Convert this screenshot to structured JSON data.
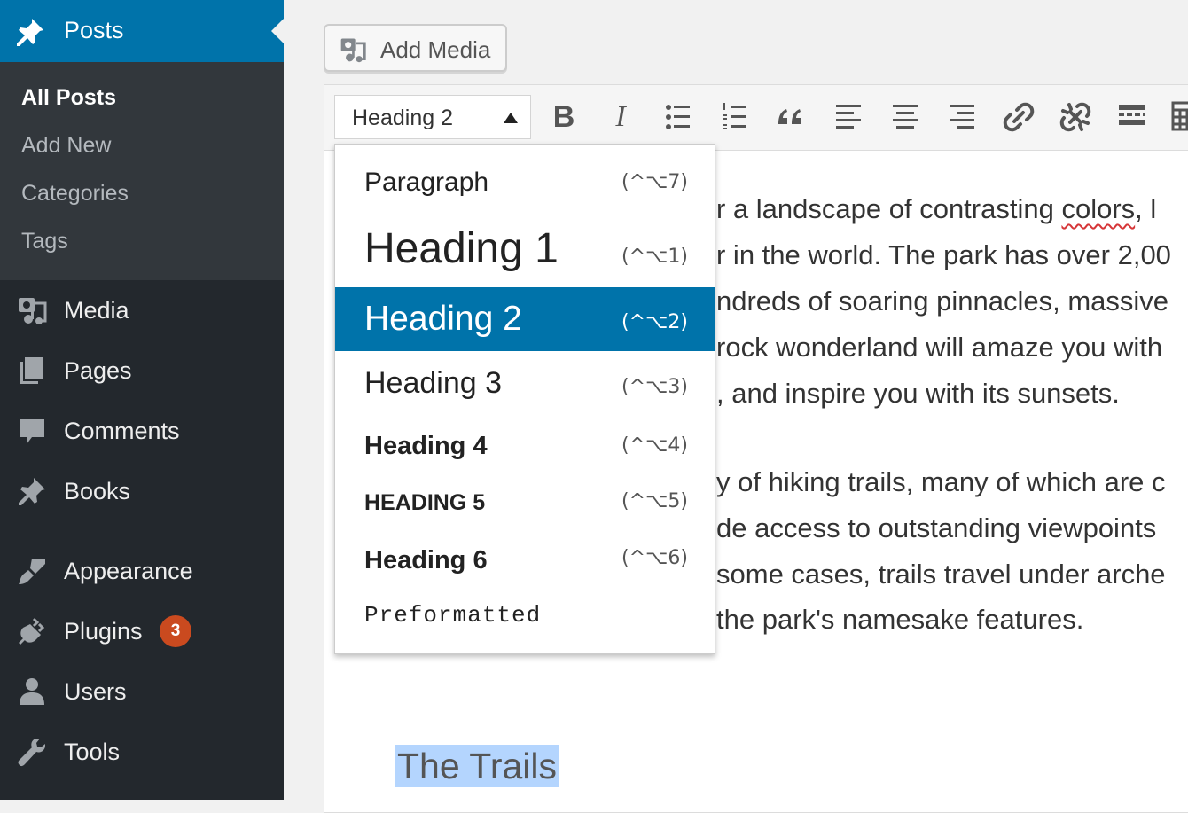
{
  "sidebar": {
    "posts_label": "Posts",
    "submenu": [
      "All Posts",
      "Add New",
      "Categories",
      "Tags"
    ],
    "items": [
      {
        "label": "Media",
        "icon": "media-icon"
      },
      {
        "label": "Pages",
        "icon": "pages-icon"
      },
      {
        "label": "Comments",
        "icon": "comments-icon"
      },
      {
        "label": "Books",
        "icon": "pin-icon"
      },
      {
        "label": "Appearance",
        "icon": "paintbrush-icon"
      },
      {
        "label": "Plugins",
        "icon": "plugin-icon",
        "badge": "3"
      },
      {
        "label": "Users",
        "icon": "users-icon"
      },
      {
        "label": "Tools",
        "icon": "wrench-icon"
      }
    ]
  },
  "toolbar": {
    "add_media_label": "Add Media",
    "format_selected": "Heading 2",
    "buttons": [
      "bold-icon",
      "italic-icon",
      "bullet-list-icon",
      "numbered-list-icon",
      "blockquote-icon",
      "align-left-icon",
      "align-center-icon",
      "align-right-icon",
      "link-icon",
      "unlink-icon",
      "read-more-icon",
      "toolbar-toggle-icon"
    ],
    "bold_glyph": "B",
    "italic_glyph": "I"
  },
  "dropdown": {
    "options": [
      {
        "label": "Paragraph",
        "shortcut": "(^⌥7)"
      },
      {
        "label": "Heading 1",
        "shortcut": "(^⌥1)"
      },
      {
        "label": "Heading 2",
        "shortcut": "(^⌥2)",
        "selected": true
      },
      {
        "label": "Heading 3",
        "shortcut": "(^⌥3)"
      },
      {
        "label": "Heading 4",
        "shortcut": "(^⌥4)"
      },
      {
        "label": "HEADING 5",
        "shortcut": "(^⌥5)"
      },
      {
        "label": "Heading 6",
        "shortcut": "(^⌥6)"
      },
      {
        "label": "Preformatted",
        "shortcut": ""
      }
    ]
  },
  "content": {
    "lines": [
      "r a landscape of contrasting ",
      "r in the world. The park has over 2,00",
      "ndreds of soaring pinnacles, massive",
      "rock wonderland will amaze you with",
      ", and inspire you with its sunsets.",
      "y of hiking trails, many of which are c",
      "de access to outstanding viewpoints",
      "some cases, trails travel under arche",
      "the park's namesake features."
    ],
    "misspelled": "colors",
    "line0_tail": ", l",
    "selected_heading": "The Trails"
  },
  "colors": {
    "sidebar_bg": "#23282d",
    "submenu_bg": "#32373c",
    "accent": "#0073aa",
    "badge": "#ca4a1f",
    "selection": "#b4d5fe"
  }
}
